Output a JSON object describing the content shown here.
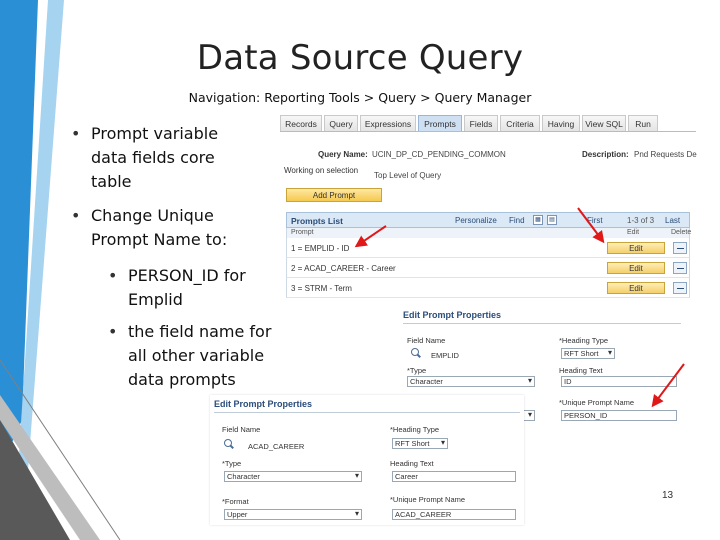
{
  "slide": {
    "title": "Data Source Query",
    "navigation": "Navigation: Reporting Tools > Query > Query Manager",
    "bullets": [
      "Prompt variable data fields core table",
      "Change Unique Prompt Name to:",
      "PERSON_ID for Emplid",
      "the field name for all other variable data prompts"
    ],
    "page_number": "13"
  },
  "query_manager": {
    "tabs": [
      "Records",
      "Query",
      "Expressions",
      "Prompts",
      "Fields",
      "Criteria",
      "Having",
      "View SQL",
      "Run"
    ],
    "active_tab": "Prompts",
    "query_name_label": "Query Name:",
    "query_name_value": "UCIN_DP_CD_PENDING_COMMON",
    "description_label": "Description:",
    "description_value": "Pnd Requests De",
    "working_on_label": "Working on selection",
    "working_on_value": "Top Level of Query",
    "add_prompt_label": "Add Prompt",
    "grid": {
      "title": "Prompts List",
      "personalize": "Personalize",
      "find": "Find",
      "first": "First",
      "count": "1-3 of 3",
      "last": "Last",
      "col_prompt": "Prompt",
      "col_edit": "Edit",
      "col_delete": "Delete",
      "edit_label": "Edit",
      "rows": [
        "1 = EMPLID - ID",
        "2 = ACAD_CAREER - Career",
        "3 = STRM - Term"
      ]
    }
  },
  "edit_prompt_1": {
    "title": "Edit Prompt Properties",
    "field_name_label": "Field Name",
    "field_name_value": "EMPLID",
    "heading_type_label": "*Heading Type",
    "heading_type_value": "RFT Short",
    "type_label": "*Type",
    "type_value": "Character",
    "heading_text_label": "Heading Text",
    "heading_text_value": "ID",
    "unique_prompt_label": "*Unique Prompt Name",
    "unique_prompt_value": "PERSON_ID"
  },
  "edit_prompt_2": {
    "title": "Edit Prompt Properties",
    "field_name_label": "Field Name",
    "field_name_value": "ACAD_CAREER",
    "heading_type_label": "*Heading Type",
    "heading_type_value": "RFT Short",
    "type_label": "*Type",
    "type_value": "Character",
    "heading_text_label": "Heading Text",
    "heading_text_value": "Career",
    "format_label": "*Format",
    "format_value": "Upper",
    "unique_prompt_label": "*Unique Prompt Name",
    "unique_prompt_value": "ACAD_CAREER"
  },
  "colors": {
    "accent_blue": "#2b8fd6",
    "light_blue": "#a6d3f0",
    "arrow_red": "#e01818",
    "header_blue": "#2b4d7a"
  }
}
